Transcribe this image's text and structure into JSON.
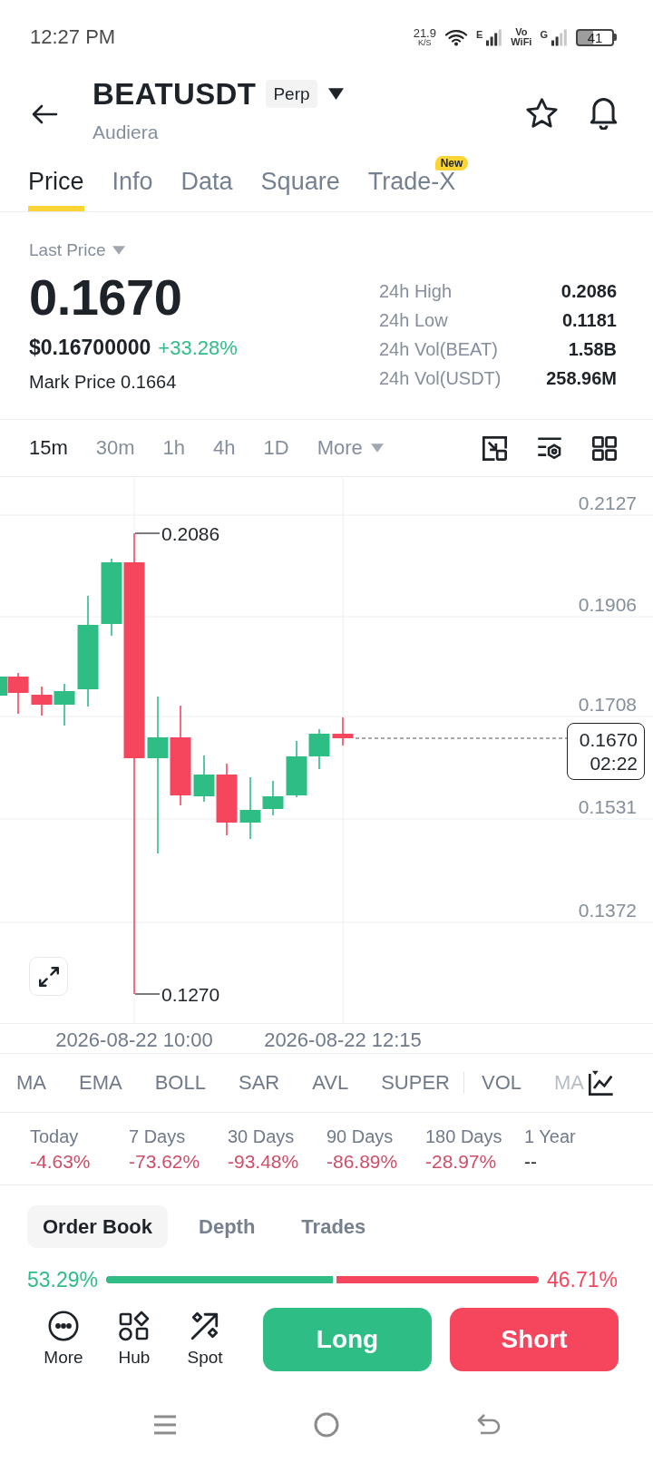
{
  "status_bar": {
    "time": "12:27 PM",
    "net_speed": "21.9",
    "net_speed_unit": "K/S",
    "network_1": "E",
    "calling_mode": "Vo WiFi",
    "network_2": "G",
    "battery": "41"
  },
  "header": {
    "symbol": "BEATUSDT",
    "badge": "Perp",
    "subtitle": "Audiera"
  },
  "tabs": [
    {
      "label": "Price",
      "selected": true
    },
    {
      "label": "Info",
      "selected": false
    },
    {
      "label": "Data",
      "selected": false
    },
    {
      "label": "Square",
      "selected": false
    },
    {
      "label": "Trade-X",
      "selected": false,
      "badge": "New"
    }
  ],
  "price": {
    "label": "Last Price",
    "value": "0.1670",
    "usd_value": "$0.16700000",
    "change": "+33.28%",
    "mark_price": "Mark Price 0.1664"
  },
  "stats": [
    {
      "label": "24h High",
      "value": "0.2086"
    },
    {
      "label": "24h Low",
      "value": "0.1181"
    },
    {
      "label": "24h Vol(BEAT)",
      "value": "1.58B"
    },
    {
      "label": "24h Vol(USDT)",
      "value": "258.96M"
    }
  ],
  "intervals": [
    {
      "label": "15m",
      "selected": true
    },
    {
      "label": "30m",
      "selected": false
    },
    {
      "label": "1h",
      "selected": false
    },
    {
      "label": "4h",
      "selected": false
    },
    {
      "label": "1D",
      "selected": false
    }
  ],
  "more_intervals": "More",
  "chart": {
    "y_labels": [
      "0.2127",
      "0.1906",
      "0.1708",
      "0.1531",
      "0.1372"
    ],
    "high_marker": "0.2086",
    "low_marker": "0.1270",
    "last_price": "0.1670",
    "countdown": "02:22",
    "x_labels": [
      "2026-08-22 10:00",
      "2026-08-22 12:15"
    ]
  },
  "indicators": {
    "main": [
      "MA",
      "EMA",
      "BOLL",
      "SAR",
      "AVL",
      "SUPER"
    ],
    "sub": [
      "VOL",
      "MA"
    ]
  },
  "performance": [
    {
      "period": "Today",
      "change": "-4.63%",
      "color": "#cf4d66"
    },
    {
      "period": "7 Days",
      "change": "-73.62%",
      "color": "#cf4d66"
    },
    {
      "period": "30 Days",
      "change": "-93.48%",
      "color": "#cf4d66"
    },
    {
      "period": "90 Days",
      "change": "-86.89%",
      "color": "#cf4d66"
    },
    {
      "period": "180 Days",
      "change": "-28.97%",
      "color": "#cf4d66"
    },
    {
      "period": "1 Year",
      "change": "--",
      "color": "#1e2329"
    }
  ],
  "order_book_tabs": [
    {
      "label": "Order Book",
      "selected": true
    },
    {
      "label": "Depth",
      "selected": false
    },
    {
      "label": "Trades",
      "selected": false
    }
  ],
  "ratio": {
    "buy": "53.29%",
    "sell": "46.71%",
    "level": 0.5329
  },
  "actions": [
    {
      "label": "More",
      "kind": "more"
    },
    {
      "label": "Hub",
      "kind": "hub"
    },
    {
      "label": "Spot",
      "kind": "spot"
    }
  ],
  "trade_buttons": [
    {
      "label": "Long",
      "kind": "buy"
    },
    {
      "label": "Short",
      "kind": "sell"
    }
  ]
}
